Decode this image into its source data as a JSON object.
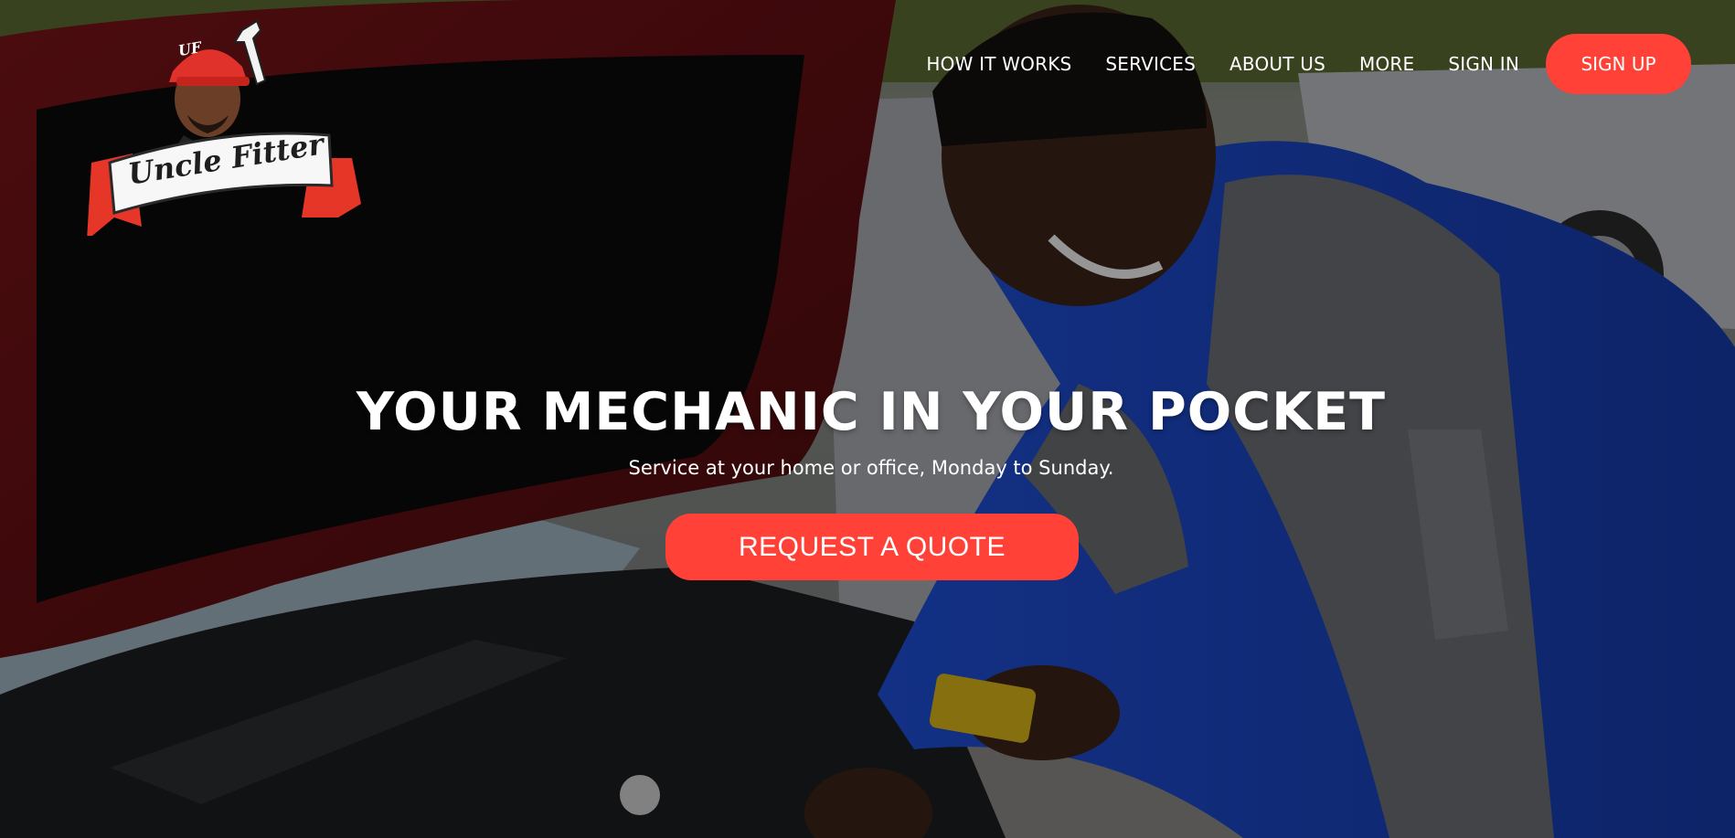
{
  "brand": {
    "name": "Uncle Fitter",
    "badge": "UF",
    "accent": "#ff4138"
  },
  "nav": {
    "items": [
      {
        "label": "HOW IT WORKS"
      },
      {
        "label": "SERVICES"
      },
      {
        "label": "ABOUT US"
      },
      {
        "label": "MORE"
      },
      {
        "label": "SIGN IN"
      }
    ],
    "signup_label": "SIGN UP"
  },
  "hero": {
    "headline": "YOUR MECHANIC IN YOUR POCKET",
    "subline": "Service at your home or office, Monday to Sunday.",
    "cta_label": "REQUEST A QUOTE",
    "image": "mechanic-working-under-car-hood"
  }
}
